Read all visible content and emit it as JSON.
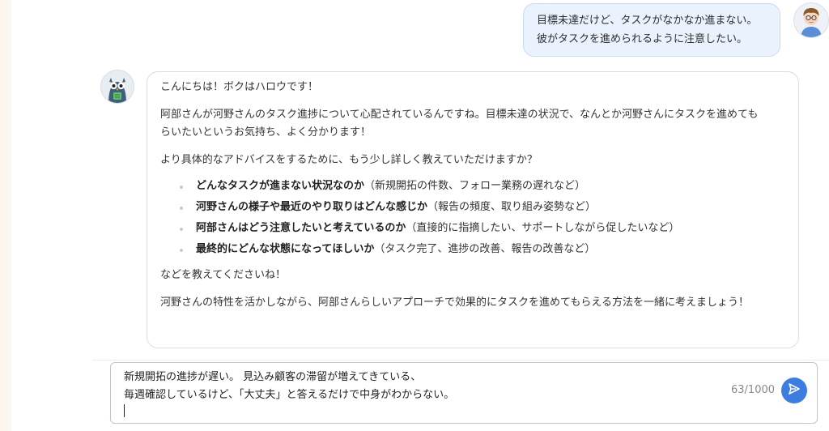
{
  "user_message": {
    "lines": [
      "目標未達だけど、タスクがなかなか進まない。",
      "彼がタスクを進められるように注意したい。"
    ],
    "avatar_icon": "user-avatar-icon"
  },
  "bot_message": {
    "avatar_icon": "owl-bot-avatar-icon",
    "greeting": "こんにちは！ボクはハロウです！",
    "intro_lines": [
      "阿部さんが河野さんのタスク進捗について心配されているんですね。目標未達の状況で、なんとか河野さんにタスクを進めても",
      "らいたいというお気持ち、よく分かります！"
    ],
    "ask": "より具体的なアドバイスをするために、もう少し詳しく教えていただけますか？",
    "items": [
      {
        "bold": "どんなタスクが進まない状況なのか",
        "detail": "（新規開拓の件数、フォロー業務の遅れなど）"
      },
      {
        "bold": "河野さんの様子や最近のやり取りはどんな感じか",
        "detail": "（報告の頻度、取り組み姿勢など）"
      },
      {
        "bold": "阿部さんはどう注意したいと考えているのか",
        "detail": "（直接的に指摘したい、サポートしながら促したいなど）"
      },
      {
        "bold": "最終的にどんな状態になってほしいか",
        "detail": "（タスク完了、進捗の改善、報告の改善など）"
      }
    ],
    "request": "などを教えてくださいね！",
    "closing": "河野さんの特性を活かしながら、阿部さんらしいアプローチで効果的にタスクを進めてもらえる方法を一緒に考えましょう！"
  },
  "input": {
    "lines": [
      "新規開拓の進捗が遅い。 見込み顧客の滞留が増えてきている、",
      "毎週確認しているけど、「大丈夫」と答えるだけで中身がわからない。"
    ],
    "counter": "63/1000",
    "send_icon": "send-icon"
  },
  "colors": {
    "user_bubble": "#eaf2fd",
    "send_button": "#3d7de0",
    "page_edge": "#fbf7ef"
  }
}
